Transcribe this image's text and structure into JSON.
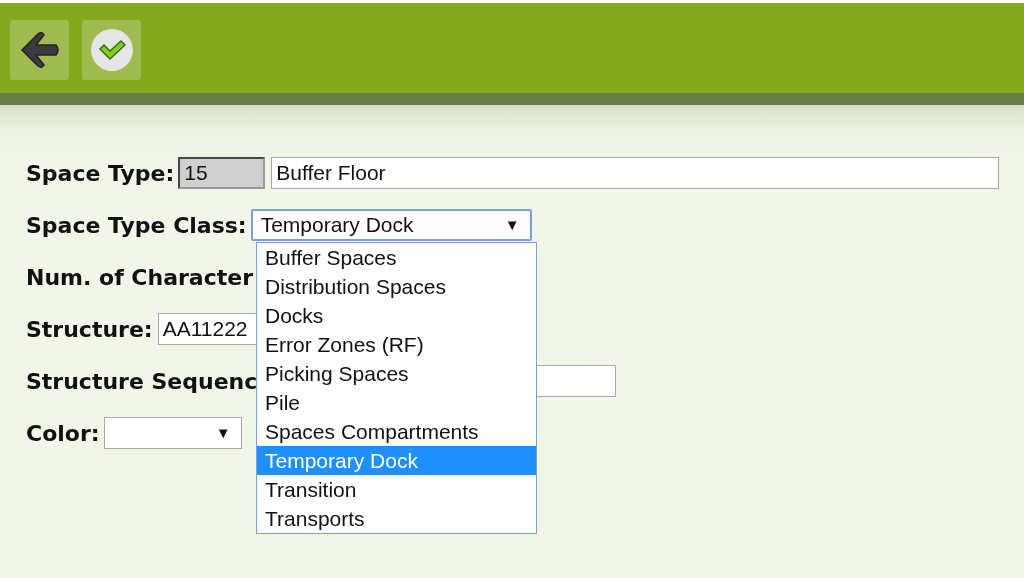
{
  "toolbar": {
    "buttons": [
      {
        "kind": "back"
      },
      {
        "kind": "confirm"
      }
    ]
  },
  "form": {
    "fields": [
      {
        "kind": "code_text",
        "label": "Space Type:",
        "code": "15",
        "value": "Buffer Floor"
      },
      {
        "kind": "select",
        "label": "Space Type Class:",
        "value": "Temporary Dock",
        "arrow": "▼",
        "expanded": true,
        "options": [
          {
            "label": "Buffer Spaces",
            "selected": false
          },
          {
            "label": "Distribution Spaces",
            "selected": false
          },
          {
            "label": "Docks",
            "selected": false
          },
          {
            "label": "Error Zones (RF)",
            "selected": false
          },
          {
            "label": "Picking Spaces",
            "selected": false
          },
          {
            "label": "Pile",
            "selected": false
          },
          {
            "label": "Spaces Compartments",
            "selected": false
          },
          {
            "label": "Temporary Dock",
            "selected": true
          },
          {
            "label": "Transition",
            "selected": false
          },
          {
            "label": "Transports",
            "selected": false
          }
        ]
      },
      {
        "kind": "label_only",
        "label": "Num. of Character"
      },
      {
        "kind": "text",
        "label": "Structure:",
        "value": "AA11222"
      },
      {
        "kind": "text",
        "label": "Structure Sequenc"
      },
      {
        "kind": "select",
        "label": "Color:",
        "arrow": "▼",
        "expanded": false
      }
    ]
  }
}
